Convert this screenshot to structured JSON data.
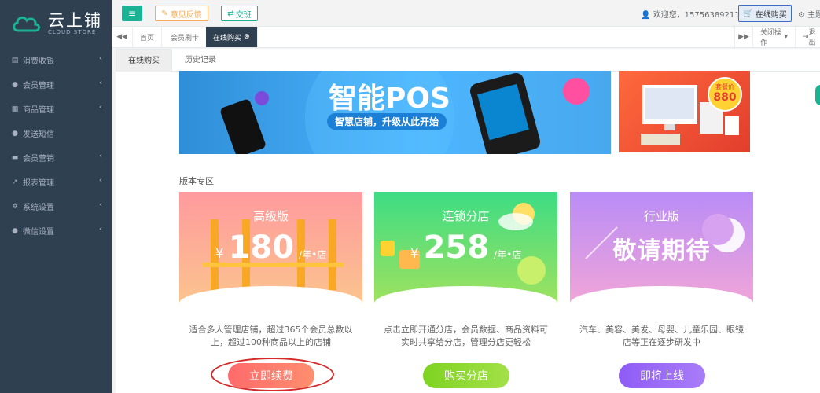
{
  "brand": {
    "name": "云上铺",
    "sub": "CLOUD STORE"
  },
  "sidebar": {
    "items": [
      {
        "icon": "menu-icon",
        "label": "消费收银"
      },
      {
        "icon": "user-icon",
        "label": "会员管理"
      },
      {
        "icon": "list-icon",
        "label": "商品管理"
      },
      {
        "icon": "comment-icon",
        "label": "发送短信"
      },
      {
        "icon": "card-icon",
        "label": "会员营销"
      },
      {
        "icon": "chart-icon",
        "label": "报表管理"
      },
      {
        "icon": "gear-icon",
        "label": "系统设置"
      },
      {
        "icon": "wechat-icon",
        "label": "微信设置"
      }
    ],
    "arrow": "‹"
  },
  "topbar": {
    "menu_glyph": "≡",
    "feedback": "意见反馈",
    "shift": "交班",
    "welcome": "欢迎您，15756389211",
    "buy": "在线购买",
    "theme": "主题"
  },
  "tabs": {
    "first": "首页",
    "items": [
      "会员刷卡",
      "在线购买"
    ],
    "close_ops": "关闭操作",
    "logout": "退出"
  },
  "subtabs": [
    "在线购买",
    "历史记录"
  ],
  "banner": {
    "headline": "智能POS",
    "tagline": "智慧店铺，升级从此开始",
    "promo_label": "套餐价",
    "promo_price": "880"
  },
  "section_title": "版本专区",
  "cards": [
    {
      "title": "高级版",
      "yen": "¥",
      "price": "180",
      "unit": "/年•店",
      "desc": "适合多人管理店铺，超过365个会员总数以上，超过100种商品以上的店铺",
      "button": "立即续费"
    },
    {
      "title": "连锁分店",
      "yen": "¥",
      "price": "258",
      "unit": "/年•店",
      "desc": "点击立即开通分店，会员数据、商品资料可实时共享给分店，管理分店更轻松",
      "button": "购买分店"
    },
    {
      "title": "行业版",
      "big": "敬请期待",
      "desc": "汽车、美容、美发、母婴、儿童乐园、眼镜店等正在逐步研发中",
      "button": "即将上线"
    }
  ],
  "colors": {
    "sidebar": "#2f4050",
    "accent": "#1ab394",
    "warn": "#f8ac59"
  }
}
